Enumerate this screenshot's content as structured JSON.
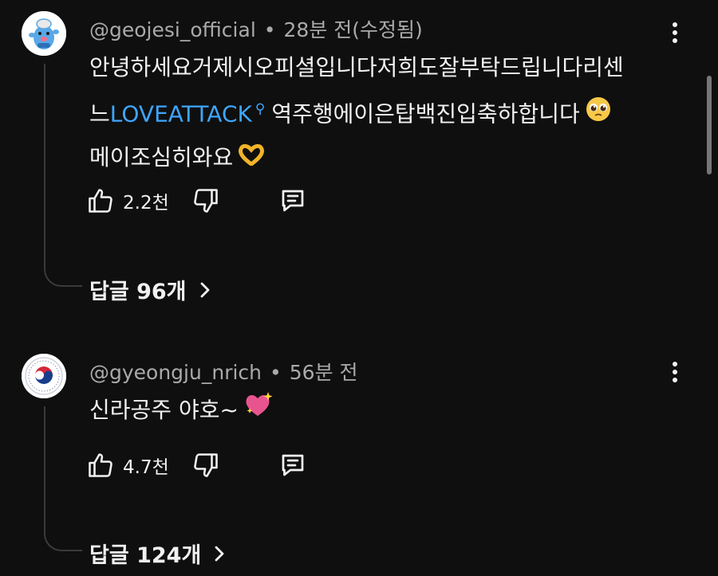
{
  "comments": [
    {
      "author": "@geojesi_official",
      "time": "28분 전(수정됨)",
      "avatar_icon": "mascot-avatar-icon",
      "line1": "안녕하세요거제시오피셜입니다저희도잘부탁드립니다리센",
      "line2_prefix": "느",
      "link_text": "LOVEATTACK",
      "line2_suffix": "역주행에이은탑백진입축하합니다",
      "line2_emoji": "pleading-face-emoji",
      "line3": "메이조심히와요",
      "line3_emoji": "heart-hands-emoji",
      "likes": "2.2천",
      "replies": "답글 96개"
    },
    {
      "author": "@gyeongju_nrich",
      "time": "56분 전",
      "avatar_icon": "government-emblem-avatar-icon",
      "line1": "신라공주 야호~",
      "line1_emoji": "sparkling-heart-emoji",
      "likes": "4.7천",
      "replies": "답글 124개"
    }
  ],
  "separator": "•",
  "colors": {
    "background": "#0f0f0f",
    "text": "#f1f1f1",
    "meta": "#aaaaaa",
    "link": "#3ea6ff"
  }
}
